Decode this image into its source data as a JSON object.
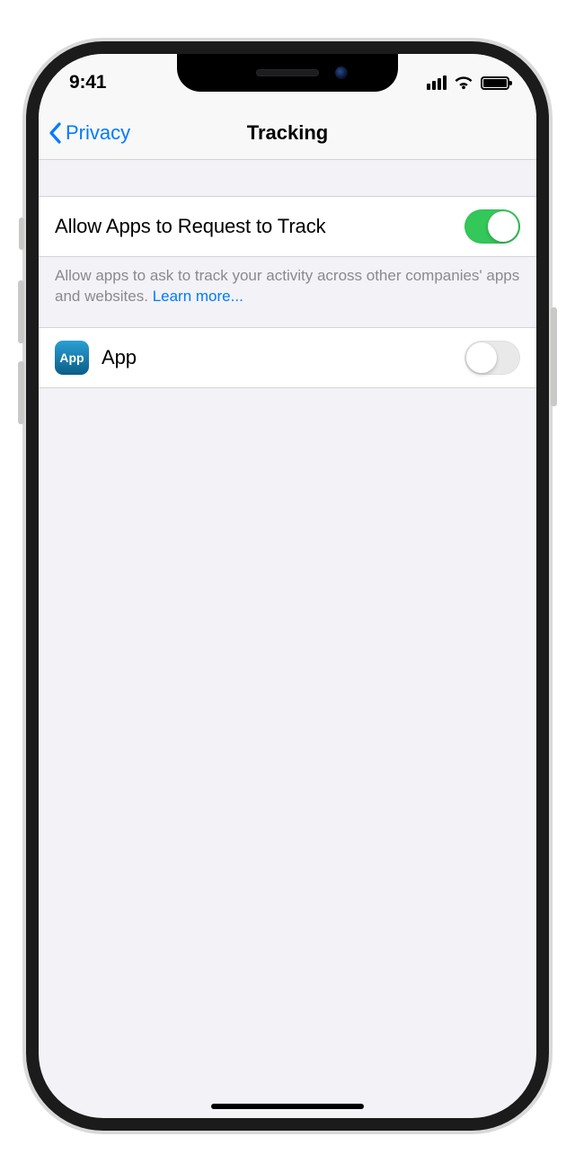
{
  "statusBar": {
    "time": "9:41"
  },
  "nav": {
    "backLabel": "Privacy",
    "title": "Tracking"
  },
  "masterToggle": {
    "label": "Allow Apps to Request to Track",
    "on": true
  },
  "footer": {
    "text": "Allow apps to ask to track your activity across other companies' apps and websites. ",
    "link": "Learn more..."
  },
  "apps": [
    {
      "icon": "App",
      "name": "App",
      "on": false
    }
  ]
}
